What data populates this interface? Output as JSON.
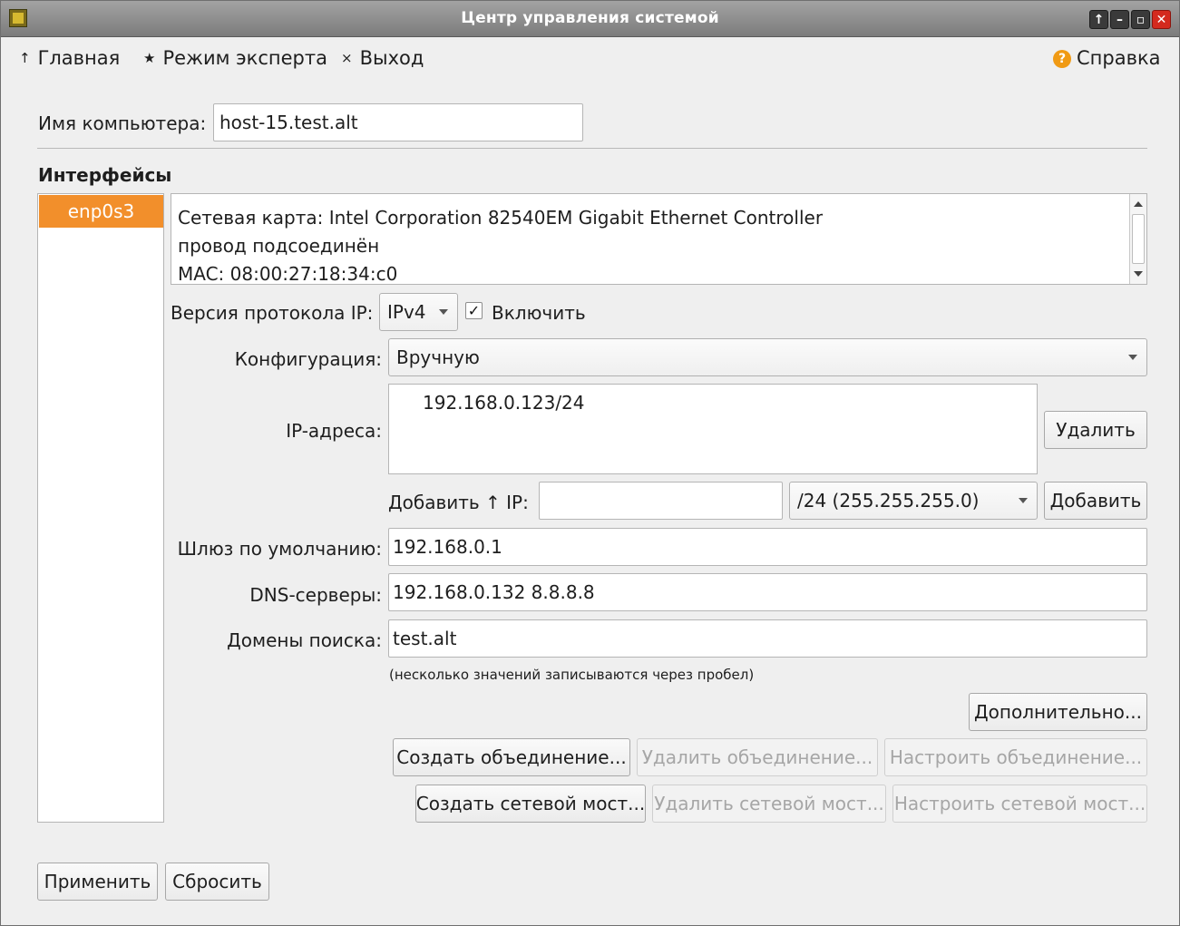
{
  "window": {
    "title": "Центр управления системой",
    "controls": [
      "maximize-icon",
      "minimize-icon",
      "restore-icon",
      "close-icon"
    ]
  },
  "menu": {
    "home_glyph": "↑",
    "home": "Главная",
    "expert_glyph": "★",
    "expert": "Режим эксперта",
    "exit_glyph": "×",
    "exit": "Выход",
    "help_glyph": "?",
    "help": "Справка"
  },
  "hostname": {
    "label": "Имя компьютера:",
    "value": "host-15.test.alt"
  },
  "interfaces": {
    "heading": "Интерфейсы",
    "items": [
      {
        "name": "enp0s3",
        "selected": true
      }
    ]
  },
  "details": {
    "card": "Сетевая карта: Intel Corporation 82540EM Gigabit Ethernet Controller",
    "link": "провод подсоединён",
    "mac": "MAC: 08:00:27:18:34:c0"
  },
  "protocol": {
    "label": "Версия протокола IP:",
    "value": "IPv4",
    "enable_label": "Включить",
    "enable_mark": "✓",
    "enabled": true
  },
  "config": {
    "label": "Конфигурация:",
    "value": "Вручную"
  },
  "ip": {
    "label": "IP-адреса:",
    "addresses": [
      "192.168.0.123/24"
    ],
    "delete_button": "Удалить",
    "add_label": "Добавить ↑ IP:",
    "add_value": "",
    "mask": "/24 (255.255.255.0)",
    "add_button": "Добавить"
  },
  "gateway": {
    "label": "Шлюз по умолчанию:",
    "value": "192.168.0.1"
  },
  "dns": {
    "label": "DNS-серверы:",
    "value": "192.168.0.132 8.8.8.8"
  },
  "search_domains": {
    "label": "Домены поиска:",
    "value": "test.alt"
  },
  "hint": "(несколько значений записываются через пробел)",
  "buttons": {
    "advanced": "Дополнительно...",
    "create_bond": "Создать объединение...",
    "delete_bond": "Удалить объединение...",
    "configure_bond": "Настроить объединение...",
    "create_bridge": "Создать сетевой мост...",
    "delete_bridge": "Удалить сетевой мост...",
    "configure_bridge": "Настроить сетевой мост...",
    "apply": "Применить",
    "reset": "Сбросить"
  }
}
